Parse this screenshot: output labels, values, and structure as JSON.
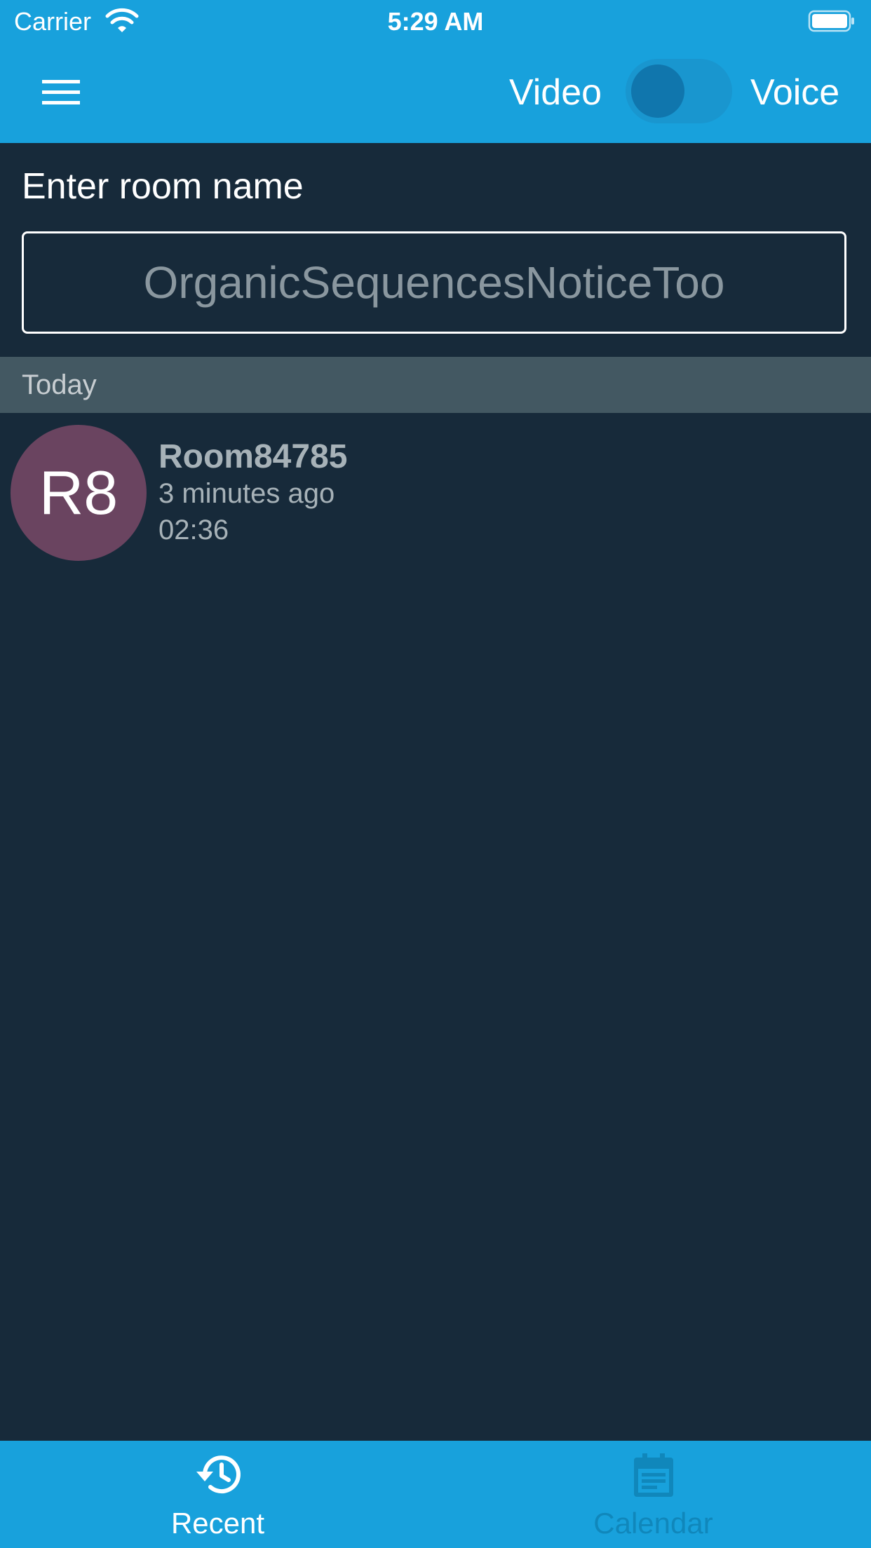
{
  "status_bar": {
    "carrier": "Carrier",
    "time": "5:29 AM",
    "wifi_icon": "wifi-icon",
    "battery_icon": "battery-icon"
  },
  "nav_bar": {
    "menu_icon": "hamburger-menu-icon",
    "toggle_left_label": "Video",
    "toggle_right_label": "Voice",
    "toggle_on": false
  },
  "room_entry": {
    "label": "Enter room name",
    "placeholder": "OrganicSequencesNoticeToo",
    "value": ""
  },
  "recent_section": {
    "header": "Today",
    "items": [
      {
        "initials": "R8",
        "title": "Room84785",
        "time_ago": "3 minutes ago",
        "duration": "02:36"
      }
    ]
  },
  "tab_bar": {
    "tabs": [
      {
        "label": "Recent",
        "icon": "history-icon",
        "active": true
      },
      {
        "label": "Calendar",
        "icon": "calendar-icon",
        "active": false
      }
    ]
  },
  "colors": {
    "primary": "#18a1dc",
    "background": "#172a3a",
    "section_header": "#435862",
    "avatar": "#6a4460"
  }
}
